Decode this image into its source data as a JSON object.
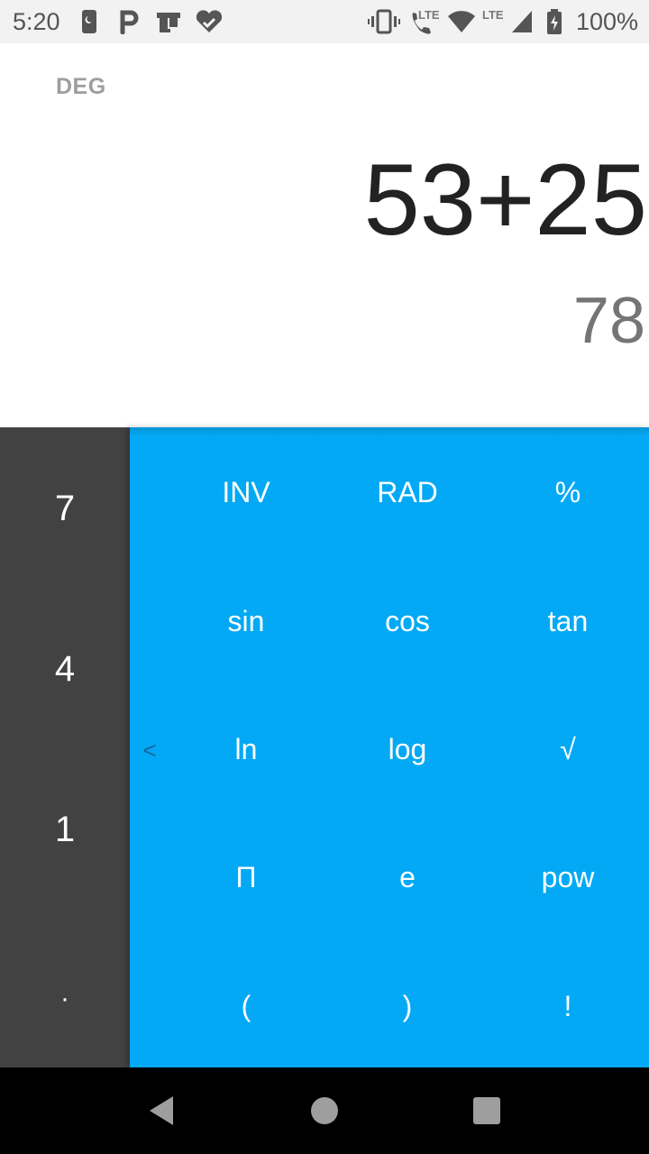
{
  "status_bar": {
    "time": "5:20",
    "network_type": "LTE",
    "network_type_2": "LTE",
    "battery_percent": "100%",
    "icons": [
      "phone-icon",
      "parking-app-icon",
      "bag-app-icon",
      "heart-check-icon",
      "vibrate-icon",
      "volte-call-icon",
      "wifi-icon",
      "signal-icon",
      "battery-icon"
    ]
  },
  "display": {
    "angle_mode": "DEG",
    "expression": "53+25",
    "result": "78"
  },
  "number_pad": {
    "keys": [
      "7",
      "4",
      "1",
      "·"
    ]
  },
  "advanced_pad": {
    "collapse_label": "<",
    "rows": [
      [
        "INV",
        "RAD",
        "%"
      ],
      [
        "sin",
        "cos",
        "tan"
      ],
      [
        "ln",
        "log",
        "√"
      ],
      [
        "Π",
        "e",
        "pow"
      ],
      [
        "(",
        ")",
        "!"
      ]
    ]
  },
  "colors": {
    "advanced_pad": "#03a9f4",
    "number_pad": "#424242",
    "expression_text": "#222222",
    "result_text": "#757575"
  },
  "nav_bar": {
    "buttons": [
      "back-icon",
      "home-icon",
      "recents-icon"
    ]
  }
}
